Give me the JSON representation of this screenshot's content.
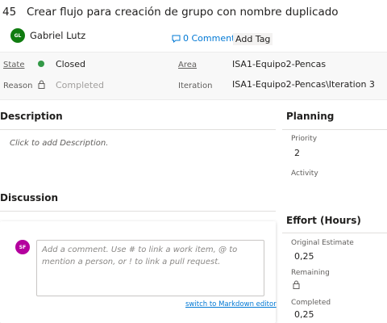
{
  "work_item": {
    "id": "45",
    "title": "Crear flujo para creación de grupo con nombre duplicado",
    "owner": {
      "initials": "GL",
      "name": "Gabriel Lutz",
      "avatar_color": "#107c10"
    },
    "comments_label": "0 Comments",
    "add_tag_label": "Add Tag"
  },
  "meta": {
    "state_label": "State",
    "state_value": "Closed",
    "state_color": "#339947",
    "reason_label": "Reason",
    "reason_value": "Completed",
    "area_label": "Area",
    "area_value": "ISA1-Equipo2-Pencas",
    "iteration_label": "Iteration",
    "iteration_value": "ISA1-Equipo2-Pencas\\Iteration 3"
  },
  "description": {
    "title": "Description",
    "placeholder": "Click to add Description."
  },
  "discussion": {
    "title": "Discussion",
    "user_initials": "SF",
    "user_avatar_color": "#b4009e",
    "comment_placeholder": "Add a comment. Use # to link a work item, @ to mention a person, or ! to link a pull request.",
    "markdown_link": "switch to Markdown editor"
  },
  "planning": {
    "title": "Planning",
    "priority_label": "Priority",
    "priority_value": "2",
    "activity_label": "Activity",
    "activity_value": ""
  },
  "effort": {
    "title": "Effort (Hours)",
    "original_label": "Original Estimate",
    "original_value": "0,25",
    "remaining_label": "Remaining",
    "completed_label": "Completed",
    "completed_value": "0,25"
  },
  "colors": {
    "accent": "#0078d4"
  }
}
